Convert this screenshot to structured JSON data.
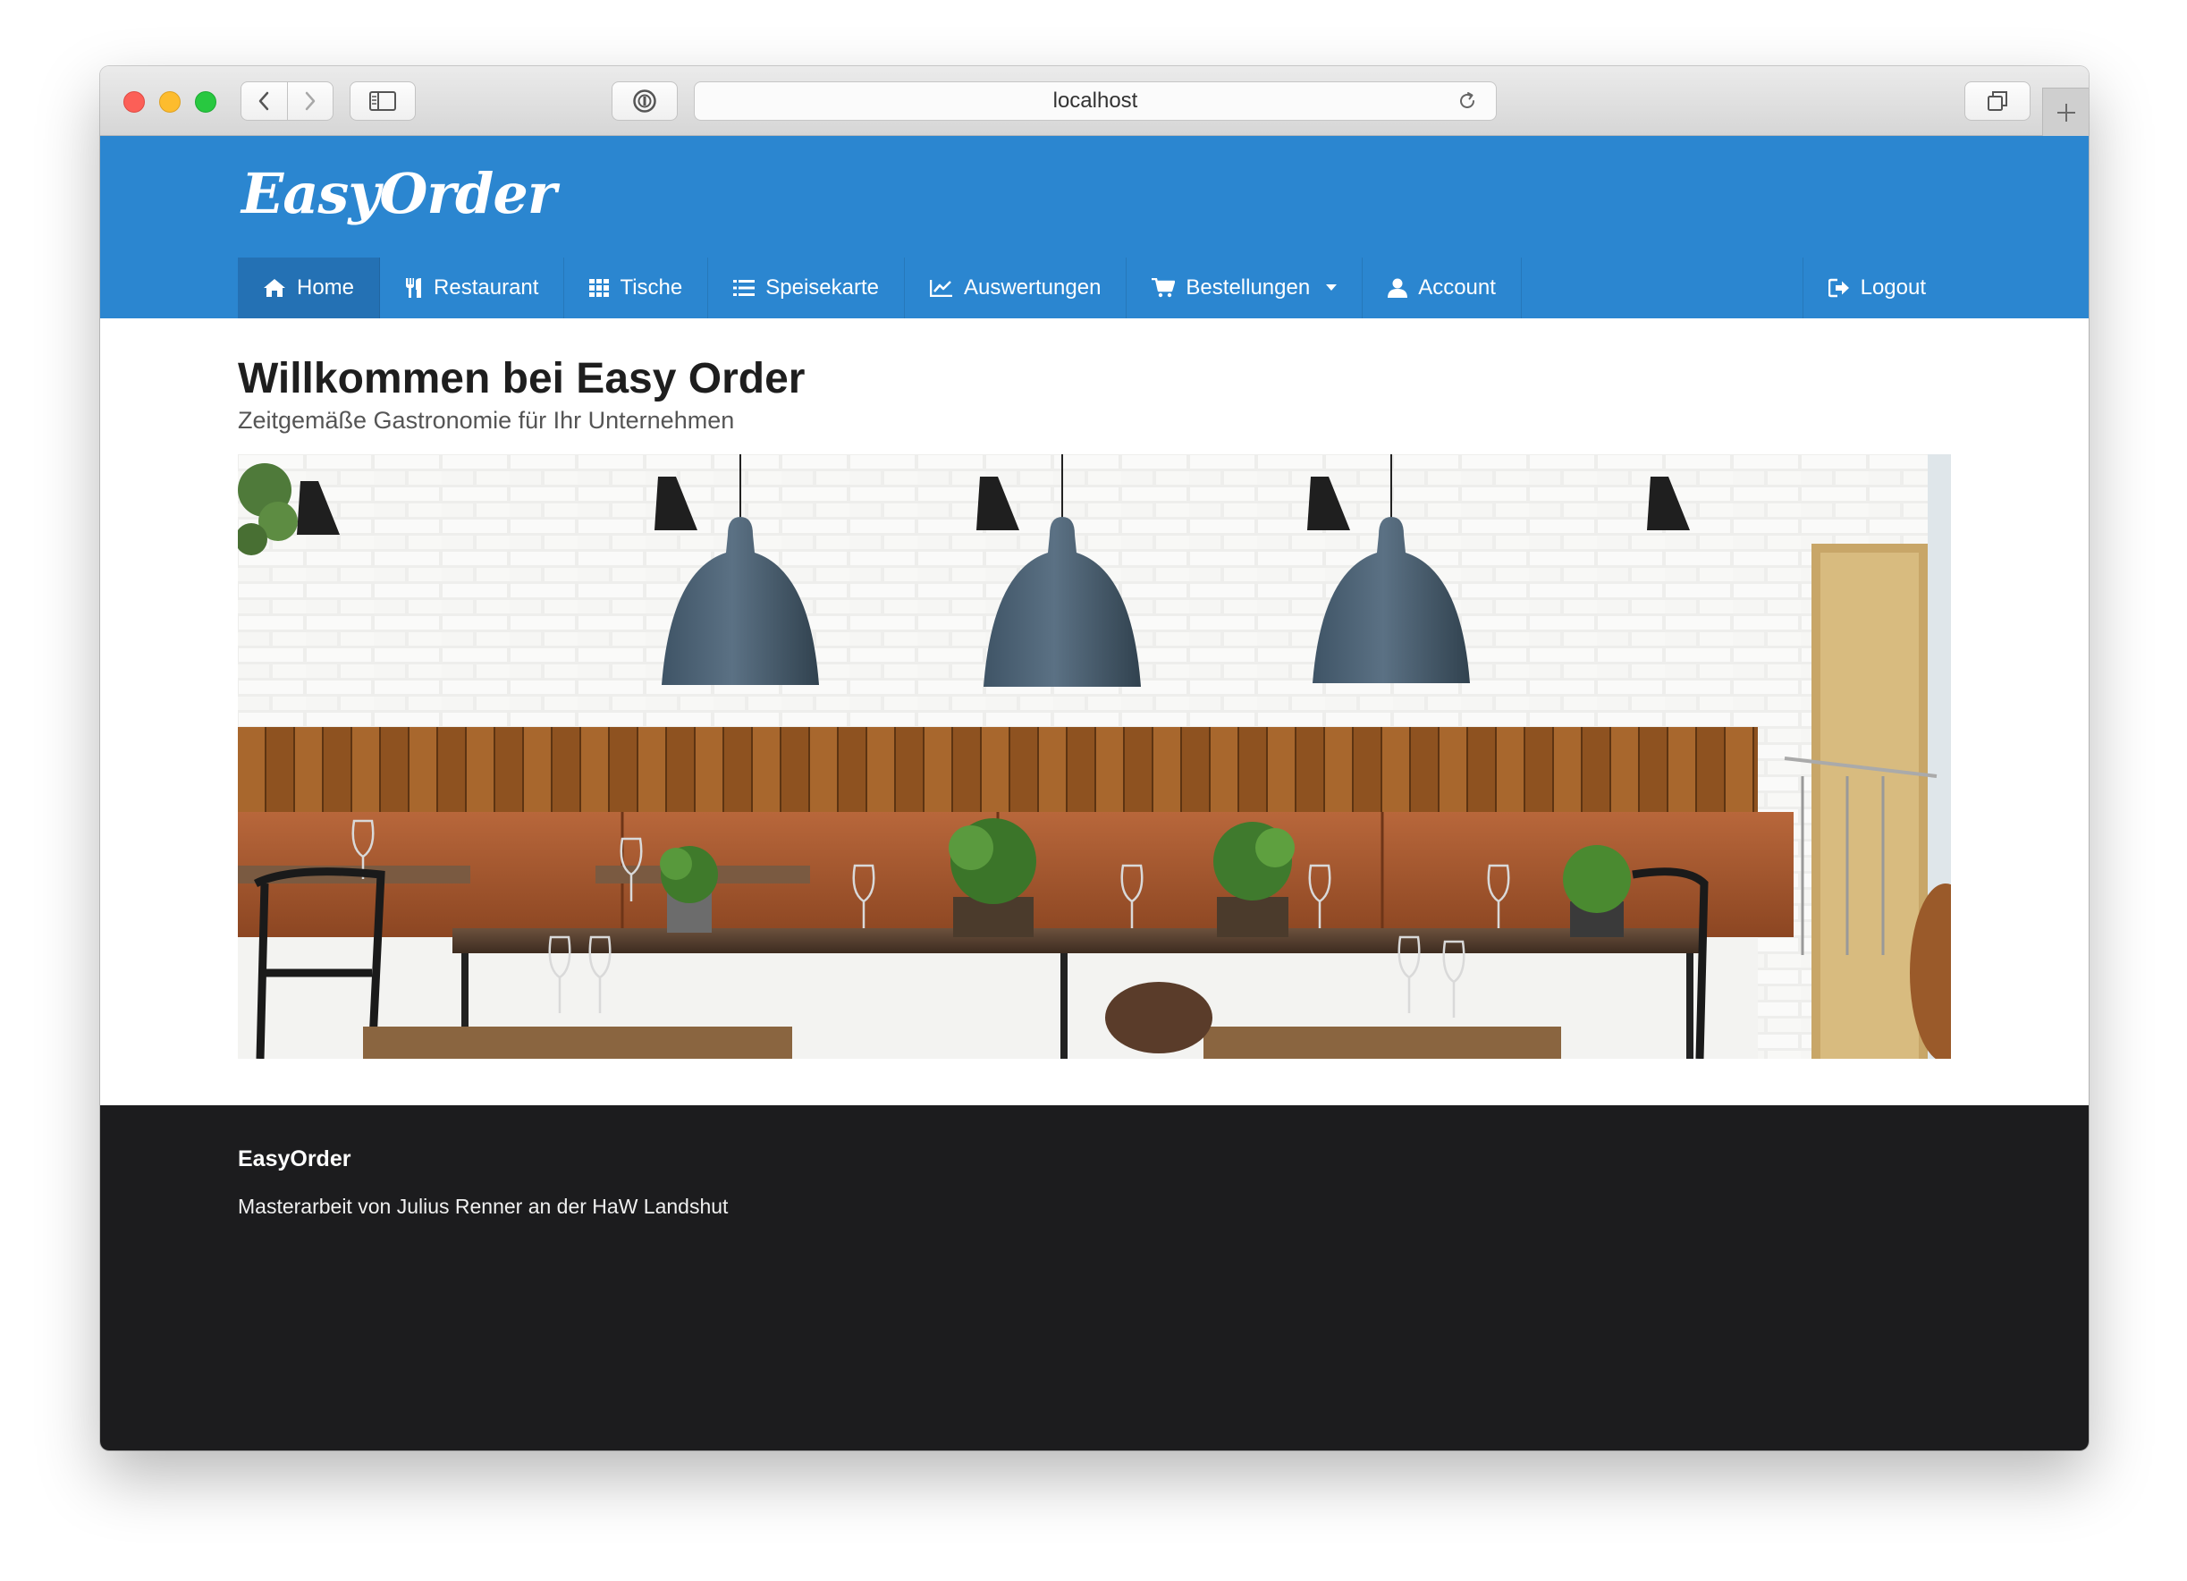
{
  "browser": {
    "address": "localhost"
  },
  "header": {
    "logo": "EasyOrder",
    "nav": [
      {
        "label": "Home",
        "icon": "home-icon",
        "active": true
      },
      {
        "label": "Restaurant",
        "icon": "utensils-icon"
      },
      {
        "label": "Tische",
        "icon": "grid-icon"
      },
      {
        "label": "Speisekarte",
        "icon": "list-icon"
      },
      {
        "label": "Auswertungen",
        "icon": "line-chart-icon"
      },
      {
        "label": "Bestellungen",
        "icon": "cart-icon",
        "dropdown": true
      },
      {
        "label": "Account",
        "icon": "user-icon"
      }
    ],
    "logout": {
      "label": "Logout",
      "icon": "logout-icon"
    }
  },
  "main": {
    "title": "Willkommen bei Easy Order",
    "subtitle": "Zeitgemäße Gastronomie für Ihr Unternehmen"
  },
  "footer": {
    "brand": "EasyOrder",
    "text": "Masterarbeit von Julius Renner an der HaW Landshut"
  },
  "colors": {
    "header": "#2b86d0",
    "nav_active": "#2471b4",
    "footer": "#1c1c1e"
  }
}
